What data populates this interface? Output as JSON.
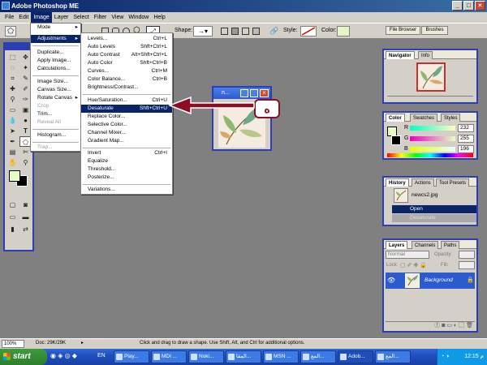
{
  "window": {
    "title": "Adobe Photoshop ME",
    "buttons": [
      "_",
      "□",
      "×"
    ]
  },
  "menubar": [
    "File",
    "Edit",
    "Image",
    "Layer",
    "Select",
    "Filter",
    "View",
    "Window",
    "Help"
  ],
  "options_bar": {
    "shape_label": "Shape:",
    "style_label": "Style:",
    "color_label": "Color:",
    "color_swatch": "#e6f5c8"
  },
  "palette_well": {
    "tabs": [
      "File Browser",
      "Brushes"
    ]
  },
  "image_menu": [
    {
      "label": "Mode",
      "submenu": true
    },
    {
      "label": "Adjustments",
      "submenu": true,
      "highlight": true
    },
    {
      "separator": true
    },
    {
      "label": "Duplicate..."
    },
    {
      "label": "Apply Image..."
    },
    {
      "label": "Calculations..."
    },
    {
      "separator": true
    },
    {
      "label": "Image Size..."
    },
    {
      "label": "Canvas Size..."
    },
    {
      "label": "Rotate Canvas",
      "submenu": true
    },
    {
      "label": "Crop",
      "disabled": true
    },
    {
      "label": "Trim..."
    },
    {
      "label": "Reveal All",
      "disabled": true
    },
    {
      "separator": true
    },
    {
      "label": "Histogram..."
    },
    {
      "separator": true
    },
    {
      "label": "Trap...",
      "disabled": true
    }
  ],
  "adjustments_menu": [
    {
      "label": "Levels...",
      "shortcut": "Ctrl+L"
    },
    {
      "label": "Auto Levels",
      "shortcut": "Shft+Ctrl+L"
    },
    {
      "label": "Auto Contrast",
      "shortcut": "Alt+Shft+Ctrl+L"
    },
    {
      "label": "Auto Color",
      "shortcut": "Shft+Ctrl+B"
    },
    {
      "label": "Curves...",
      "shortcut": "Ctrl+M"
    },
    {
      "label": "Color Balance...",
      "shortcut": "Ctrl+B"
    },
    {
      "label": "Brightness/Contrast..."
    },
    {
      "separator": true
    },
    {
      "label": "Hue/Saturation...",
      "shortcut": "Ctrl+U"
    },
    {
      "label": "Desaturate",
      "shortcut": "Shft+Ctrl+U",
      "highlight": true
    },
    {
      "label": "Replace Color..."
    },
    {
      "label": "Selective Color..."
    },
    {
      "label": "Channel Mixer..."
    },
    {
      "label": "Gradient Map..."
    },
    {
      "separator": true
    },
    {
      "label": "Invert",
      "shortcut": "Ctrl+I"
    },
    {
      "label": "Equalize"
    },
    {
      "label": "Threshold..."
    },
    {
      "label": "Posterize..."
    },
    {
      "separator": true
    },
    {
      "label": "Variations..."
    }
  ],
  "document_window": {
    "title": "n...",
    "annotation": "ه"
  },
  "navigator": {
    "tabs": [
      "Navigator",
      "Info"
    ]
  },
  "color_panel": {
    "tabs": [
      "Color",
      "Swatches",
      "Styles"
    ],
    "channels": [
      {
        "label": "R",
        "value": "232",
        "fraction": 0.91
      },
      {
        "label": "G",
        "value": "255",
        "fraction": 1.0
      },
      {
        "label": "B",
        "value": "196",
        "fraction": 0.77
      }
    ],
    "fg_color": "#e8ffc4"
  },
  "history": {
    "tabs": [
      "History",
      "Actions",
      "Tool Presets"
    ],
    "snapshot": "newcs2.jpg",
    "states": [
      {
        "label": "Open",
        "active": true
      },
      {
        "label": "Desaturate",
        "active": false
      }
    ]
  },
  "layers": {
    "tabs": [
      "Layers",
      "Channels",
      "Paths"
    ],
    "blend_mode": "Normal",
    "opacity_label": "Opacity:",
    "lock_label": "Lock:",
    "fill_label": "Fill:",
    "layer_name": "Background"
  },
  "status": {
    "zoom": "100%",
    "doc": "Doc: 29K/29K",
    "hint": "Click and drag to draw a shape. Use Shift, Alt, and Ctrl for additional options."
  },
  "taskbar": {
    "start": "start",
    "lang": "EN",
    "items": [
      "Play...",
      "MDI ...",
      "Noki...",
      "المقا...",
      "MSN ...",
      "المع...",
      "Adob...",
      "المع..."
    ],
    "clock": "12:15 م"
  },
  "colors": {
    "accent": "#0a246a",
    "arrow": "#8b0e22",
    "panel_border": "#2b3fb0"
  }
}
